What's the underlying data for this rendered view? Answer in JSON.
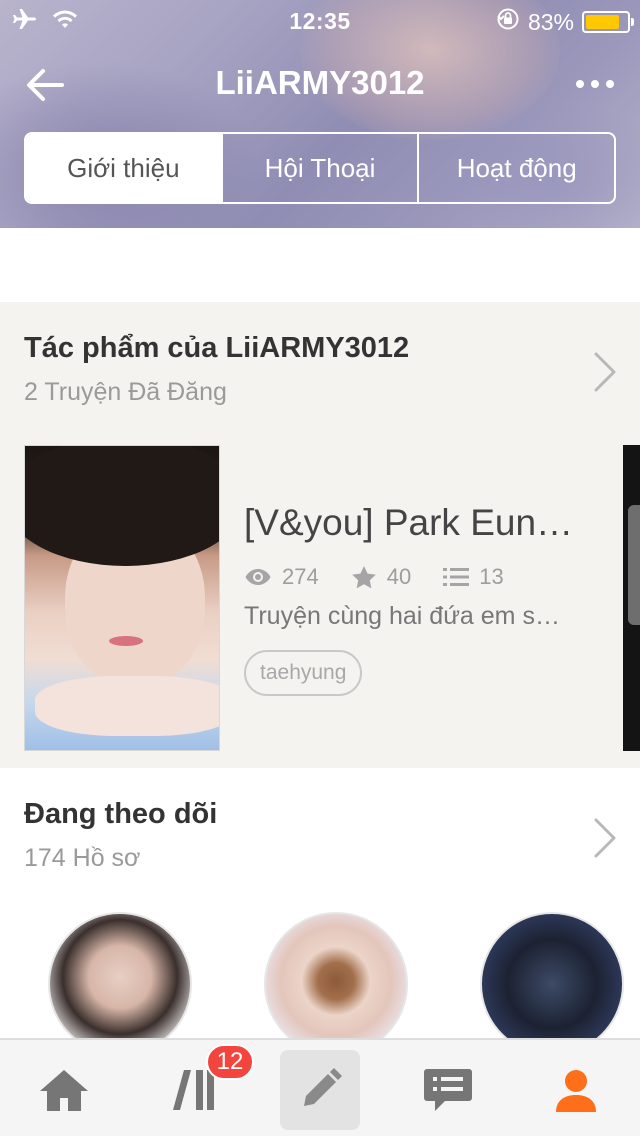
{
  "status_bar": {
    "time": "12:35",
    "battery_percent": "83%",
    "battery_level": 0.83,
    "battery_color": "#ffc800",
    "icons": [
      "airplane-icon",
      "wifi-icon",
      "rotation-lock-icon",
      "battery-icon"
    ]
  },
  "nav": {
    "title": "LiiARMY3012",
    "back_icon": "back-arrow-icon",
    "more_icon": "more-icon"
  },
  "tabs": [
    {
      "label": "Giới thiệu",
      "active": true
    },
    {
      "label": "Hội Thoại",
      "active": false
    },
    {
      "label": "Hoạt động",
      "active": false
    }
  ],
  "works": {
    "title": "Tác phẩm của LiiARMY3012",
    "subtitle": "2 Truyện Đã Đăng",
    "story": {
      "title": "[V&you] Park Eun…",
      "reads": "274",
      "votes": "40",
      "parts": "13",
      "description": "Truyện cùng hai đứa em s…",
      "tag": "taehyung"
    }
  },
  "following": {
    "title": "Đang theo dõi",
    "subtitle": "174 Hồ sơ"
  },
  "tabbar": {
    "items": [
      "home-icon",
      "library-icon",
      "write-icon",
      "messages-icon",
      "profile-icon"
    ],
    "library_badge": "12",
    "active_color": "#ff6f1a",
    "inactive_color": "#757575"
  }
}
